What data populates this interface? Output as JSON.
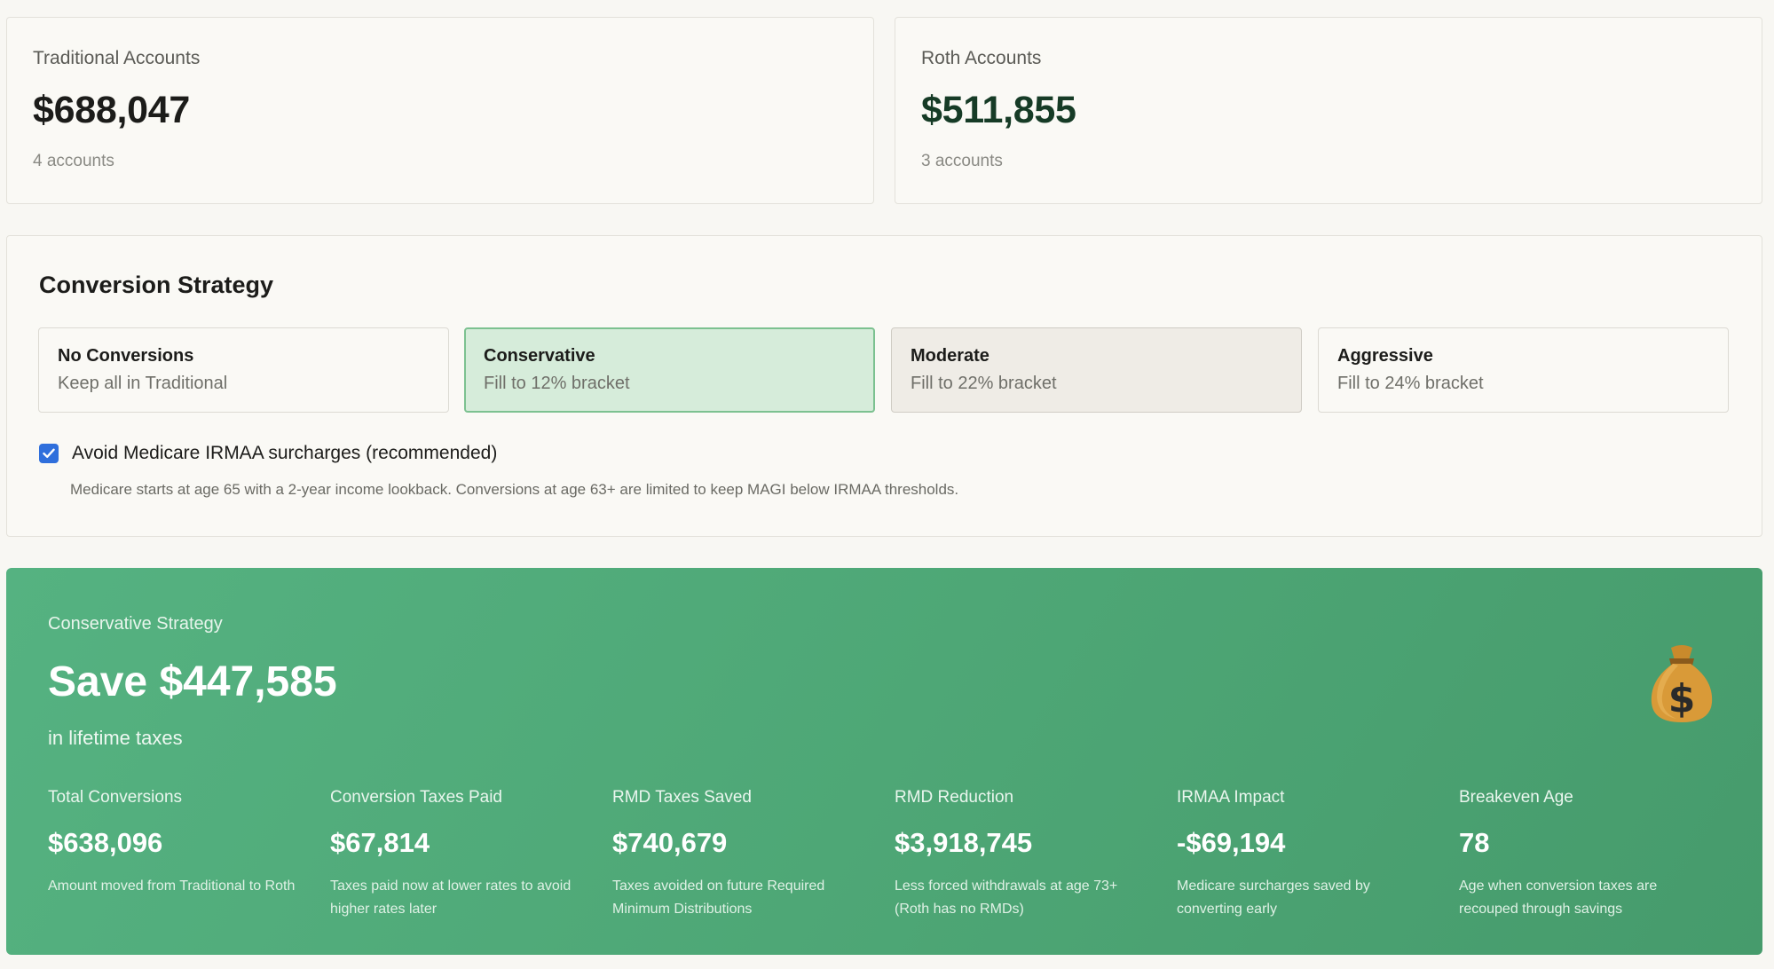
{
  "traditional": {
    "label": "Traditional Accounts",
    "value": "$688,047",
    "count": "4 accounts"
  },
  "roth": {
    "label": "Roth Accounts",
    "value": "$511,855",
    "count": "3 accounts"
  },
  "strategy": {
    "title": "Conversion Strategy",
    "options": [
      {
        "name": "No Conversions",
        "desc": "Keep all in Traditional"
      },
      {
        "name": "Conservative",
        "desc": "Fill to 12% bracket"
      },
      {
        "name": "Moderate",
        "desc": "Fill to 22% bracket"
      },
      {
        "name": "Aggressive",
        "desc": "Fill to 24% bracket"
      }
    ],
    "selected": "Conservative",
    "irmaa_checked": true,
    "irmaa_label": "Avoid Medicare IRMAA surcharges (recommended)",
    "irmaa_note": "Medicare starts at age 65 with a 2-year income lookback. Conversions at age 63+ are limited to keep MAGI below IRMAA thresholds."
  },
  "savings": {
    "subtitle": "Conservative Strategy",
    "headline": "Save $447,585",
    "caption": "in lifetime taxes",
    "icon": "money-bag-icon",
    "metrics": [
      {
        "label": "Total Conversions",
        "value": "$638,096",
        "desc": "Amount moved from Traditional to Roth"
      },
      {
        "label": "Conversion Taxes Paid",
        "value": "$67,814",
        "desc": "Taxes paid now at lower rates to avoid higher rates later"
      },
      {
        "label": "RMD Taxes Saved",
        "value": "$740,679",
        "desc": "Taxes avoided on future Required Minimum Distributions"
      },
      {
        "label": "RMD Reduction",
        "value": "$3,918,745",
        "desc": "Less forced withdrawals at age 73+ (Roth has no RMDs)"
      },
      {
        "label": "IRMAA Impact",
        "value": "-$69,194",
        "desc": "Medicare surcharges saved by converting early"
      },
      {
        "label": "Breakeven Age",
        "value": "78",
        "desc": "Age when conversion taxes are recouped through savings"
      }
    ]
  },
  "colors": {
    "selected_bg": "#d6ecda",
    "selected_border": "#7cc190",
    "panel_green": "#4ea776",
    "checkbox_blue": "#2f6fdc",
    "roth_value": "#163b26"
  }
}
